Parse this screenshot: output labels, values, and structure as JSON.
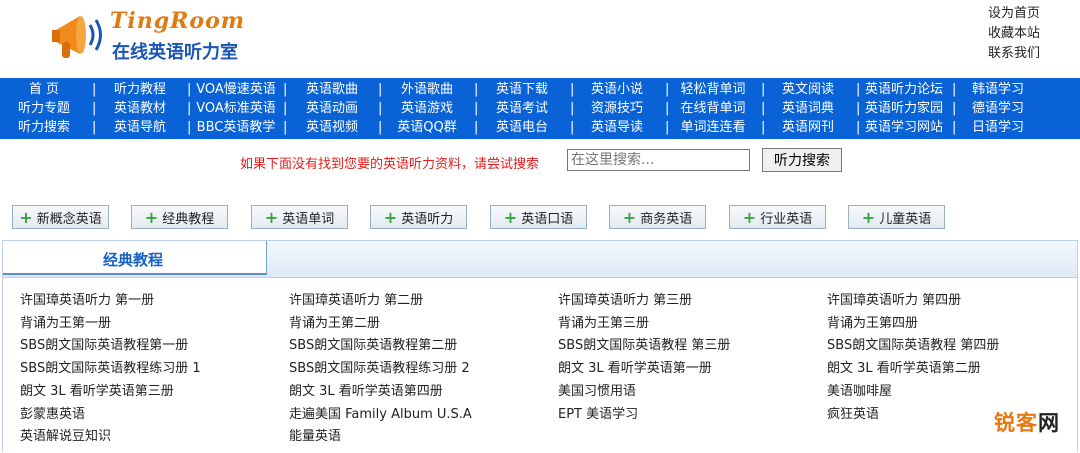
{
  "header": {
    "logo_top": "TingRoom",
    "logo_bottom": "在线英语听力室",
    "links": [
      "设为首页",
      "收藏本站",
      "联系我们"
    ]
  },
  "nav": {
    "rows": [
      [
        "首 页",
        "听力教程",
        "VOA慢速英语",
        "英语歌曲",
        "外语歌曲",
        "英语下载",
        "英语小说",
        "轻松背单词",
        "英文阅读",
        "英语听力论坛",
        "韩语学习"
      ],
      [
        "听力专题",
        "英语教材",
        "VOA标准英语",
        "英语动画",
        "英语游戏",
        "英语考试",
        "资源技巧",
        "在线背单词",
        "英语词典",
        "英语听力家园",
        "德语学习"
      ],
      [
        "听力搜索",
        "英语导航",
        "BBC英语教学",
        "英语视频",
        "英语QQ群",
        "英语电台",
        "英语导读",
        "单词连连看",
        "英语网刊",
        "英语学习网站",
        "日语学习"
      ]
    ]
  },
  "search": {
    "label": "如果下面没有找到您要的英语听力资料，请尝试搜索",
    "placeholder": "在这里搜索...",
    "button": "听力搜索"
  },
  "categories": [
    "新概念英语",
    "经典教程",
    "英语单词",
    "英语听力",
    "英语口语",
    "商务英语",
    "行业英语",
    "儿童英语"
  ],
  "panel": {
    "title": "经典教程",
    "rows": [
      [
        "许国璋英语听力 第一册",
        "许国璋英语听力 第二册",
        "许国璋英语听力 第三册",
        "许国璋英语听力 第四册"
      ],
      [
        "背诵为王第一册",
        "背诵为王第二册",
        "背诵为王第三册",
        "背诵为王第四册"
      ],
      [
        "SBS朗文国际英语教程第一册",
        "SBS朗文国际英语教程第二册",
        "SBS朗文国际英语教程 第三册",
        "SBS朗文国际英语教程 第四册"
      ],
      [
        "SBS朗文国际英语教程练习册 1",
        "SBS朗文国际英语教程练习册 2",
        "朗文 3L 看听学英语第一册",
        "朗文 3L 看听学英语第二册"
      ],
      [
        "朗文 3L 看听学英语第三册",
        "朗文 3L 看听学英语第四册",
        "美国习惯用语",
        "美语咖啡屋"
      ],
      [
        "彭蒙惠英语",
        "走遍美国 Family Album U.S.A",
        "EPT 美语学习",
        "疯狂英语"
      ],
      [
        "英语解说豆知识",
        "能量英语",
        "",
        ""
      ]
    ]
  },
  "watermark": {
    "brand": "锐客",
    "suffix": "网"
  },
  "colors": {
    "nav_bg": "#0a63d6",
    "accent": "#1a62c6",
    "search_label": "#e51b1b",
    "logo_orange": "#e07a12"
  }
}
